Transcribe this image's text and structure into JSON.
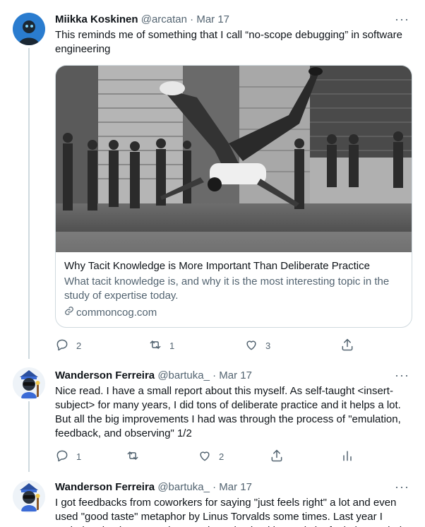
{
  "tweets": [
    {
      "name": "Miikka Koskinen",
      "handle": "@arcatan",
      "sep": "·",
      "date": "Mar 17",
      "more": "···",
      "text": "This reminds me of something that I call “no-scope debugging” in software engineering",
      "card": {
        "title": "Why Tacit Knowledge is More Important Than Deliberate Practice",
        "description": "What tacit knowledge is, and why it is the most interesting topic in the study of expertise today.",
        "domain": "commoncog.com"
      },
      "actions": {
        "reply_count": "2",
        "retweet_count": "1",
        "like_count": "3"
      }
    },
    {
      "name": "Wanderson Ferreira",
      "handle": "@bartuka_",
      "sep": "·",
      "date": "Mar 17",
      "more": "···",
      "text": "Nice read. I have a small report about this myself. As self-taught <insert-subject> for many years, I did tons of deliberate practice and it helps a lot. But all the big improvements I had was through the process of \"emulation, feedback, and observing\" 1/2",
      "actions": {
        "reply_count": "1",
        "like_count": "2"
      }
    },
    {
      "name": "Wanderson Ferreira",
      "handle": "@bartuka_",
      "sep": "·",
      "date": "Mar 17",
      "more": "···",
      "text": "I got feedbacks from coworkers for saying \"just feels right\" a lot and even used \"good taste\" metaphor by Linus Torvalds some times. Last year I ended up buying a wooden puzzle and solved it mostly by feel; then I tried to put the"
    }
  ],
  "icons": {
    "reply": "reply-icon",
    "retweet": "retweet-icon",
    "like": "heart-icon",
    "share": "share-icon",
    "analytics": "analytics-icon",
    "link": "link-icon"
  },
  "colors": {
    "text": "#0f1419",
    "muted": "#536471",
    "border": "#cfd9de",
    "thread_line": "#cfd9de"
  }
}
